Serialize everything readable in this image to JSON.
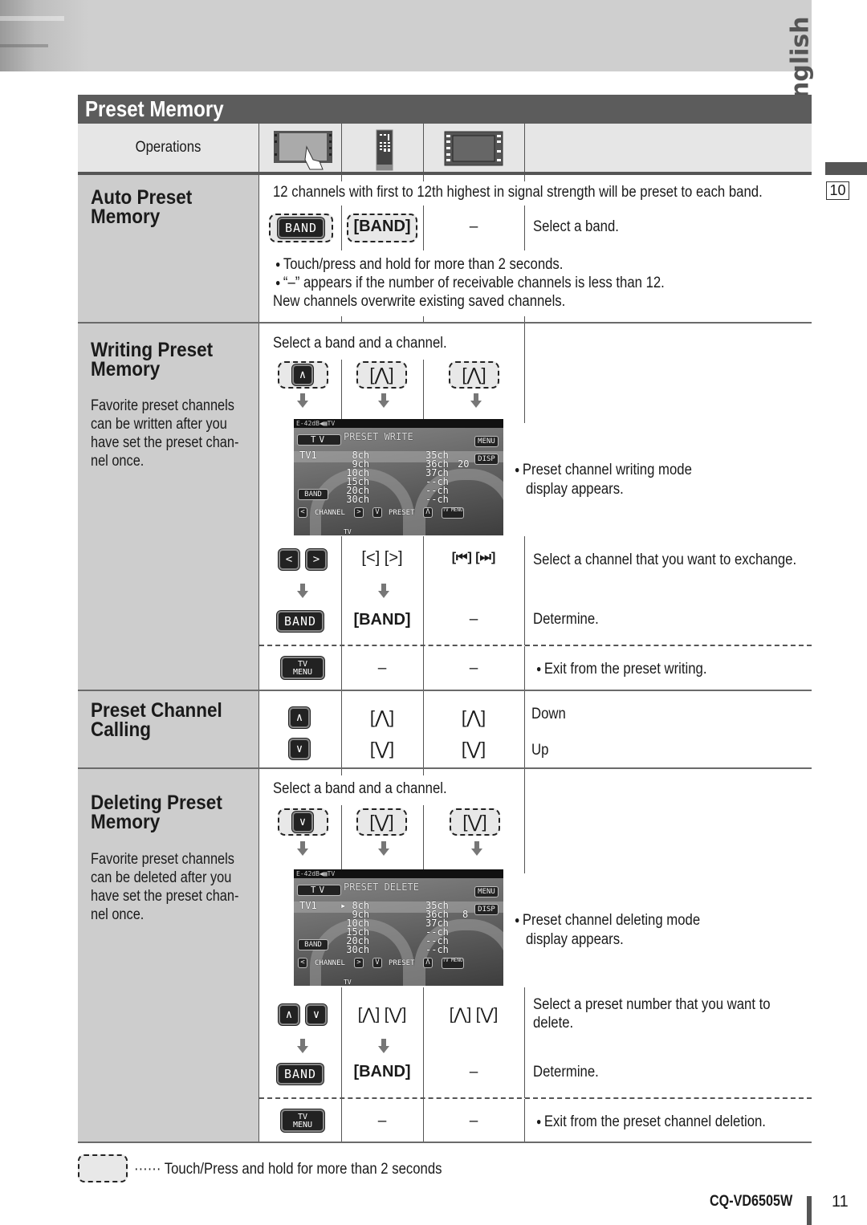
{
  "language_tab": "English",
  "page_ref": "10",
  "title": "Preset Memory",
  "operations": {
    "label": "Operations",
    "columns": [
      {
        "icon": "touch-panel-icon"
      },
      {
        "icon": "remote-control-icon"
      },
      {
        "icon": "head-unit-icon"
      }
    ]
  },
  "auto_preset": {
    "title_line1": "Auto Preset",
    "title_line2": "Memory",
    "intro": "12 channels with first to 12th highest in signal strength will be preset to each band.",
    "touch_key": "BAND",
    "remote_key": "[BAND]",
    "unit_key": "–",
    "action": "Select a band.",
    "note1": "Touch/press and hold for more than 2 seconds.",
    "note2": "“–” appears if the number of receivable channels is less than 12.",
    "note3": "New channels overwrite existing saved channels."
  },
  "writing_preset": {
    "title_line1": "Writing Preset",
    "title_line2": "Memory",
    "desc": [
      "Favorite preset channels",
      "can be written after you",
      "have set the preset chan-",
      "nel once."
    ],
    "intro": "Select a band and a channel.",
    "step1": {
      "touch_key": "∧",
      "remote_key": "[⋀]",
      "unit_key": "[⋀]"
    },
    "screen": {
      "status": "E-42dB◀▦TV",
      "mode": "TV",
      "heading": "PRESET WRITE",
      "menu": "MENU",
      "disp": "DISP",
      "band_label": "TV1",
      "left_list": "  8ch\n  9ch\n 10ch\n 15ch\n 20ch\n 30ch",
      "right_list": "35ch\n36ch\n37ch\n--ch\n--ch\n--ch",
      "counter": "20",
      "band_btn": "BAND",
      "channel": "CHANNEL",
      "preset": "PRESET",
      "tv_menu": "TV MENU",
      "bottom": "TV"
    },
    "screen_note_line1": "Preset channel writing mode",
    "screen_note_line2": "display appears.",
    "step2": {
      "touch_keys": [
        "<",
        ">"
      ],
      "remote_key": "[<] [>]",
      "unit_key": "[⏮] [⏭]",
      "action": "Select a channel that you want to exchange."
    },
    "step3": {
      "touch_key": "BAND",
      "remote_key": "[BAND]",
      "unit_key": "–",
      "action": "Determine."
    },
    "exit": {
      "touch_key_line1": "TV",
      "touch_key_line2": "MENU",
      "remote_key": "–",
      "unit_key": "–",
      "action": "Exit from the preset writing."
    }
  },
  "calling": {
    "title_line1": "Preset Channel",
    "title_line2": "Calling",
    "rows": [
      {
        "touch_key": "∧",
        "remote_key": "[⋀]",
        "unit_key": "[⋀]",
        "action": "Down"
      },
      {
        "touch_key": "∨",
        "remote_key": "[⋁]",
        "unit_key": "[⋁]",
        "action": "Up"
      }
    ]
  },
  "deleting_preset": {
    "title_line1": "Deleting Preset",
    "title_line2": "Memory",
    "desc": [
      "Favorite preset channels",
      "can be deleted after you",
      "have set the preset chan-",
      "nel once."
    ],
    "intro": "Select a band and a channel.",
    "step1": {
      "touch_key": "∨",
      "remote_key": "[⋁]",
      "unit_key": "[⋁]"
    },
    "screen": {
      "status": "E-42dB◀▦TV",
      "mode": "TV",
      "heading": "PRESET DELETE",
      "menu": "MENU",
      "disp": "DISP",
      "band_label": "TV1",
      "left_list": "▸ 8ch\n  9ch\n 10ch\n 15ch\n 20ch\n 30ch",
      "right_list": "35ch\n36ch\n37ch\n--ch\n--ch\n--ch",
      "counter": "8",
      "band_btn": "BAND",
      "channel": "CHANNEL",
      "preset": "PRESET",
      "tv_menu": "TV MENU",
      "bottom": "TV"
    },
    "screen_note_line1": "Preset channel deleting mode",
    "screen_note_line2": "display appears.",
    "step2": {
      "touch_keys": [
        "∧",
        "∨"
      ],
      "remote_key": "[⋀] [⋁]",
      "unit_key": "[⋀] [⋁]",
      "action_line1": "Select a preset number that you want to",
      "action_line2": "delete."
    },
    "step3": {
      "touch_key": "BAND",
      "remote_key": "[BAND]",
      "unit_key": "–",
      "action": "Determine."
    },
    "exit": {
      "touch_key_line1": "TV",
      "touch_key_line2": "MENU",
      "remote_key": "–",
      "unit_key": "–",
      "action": "Exit from the preset channel deletion."
    }
  },
  "legend": {
    "dots": "······",
    "text": "Touch/Press and hold for more than 2 seconds"
  },
  "footer": {
    "model": "CQ-VD6505W",
    "page_number": "11"
  }
}
